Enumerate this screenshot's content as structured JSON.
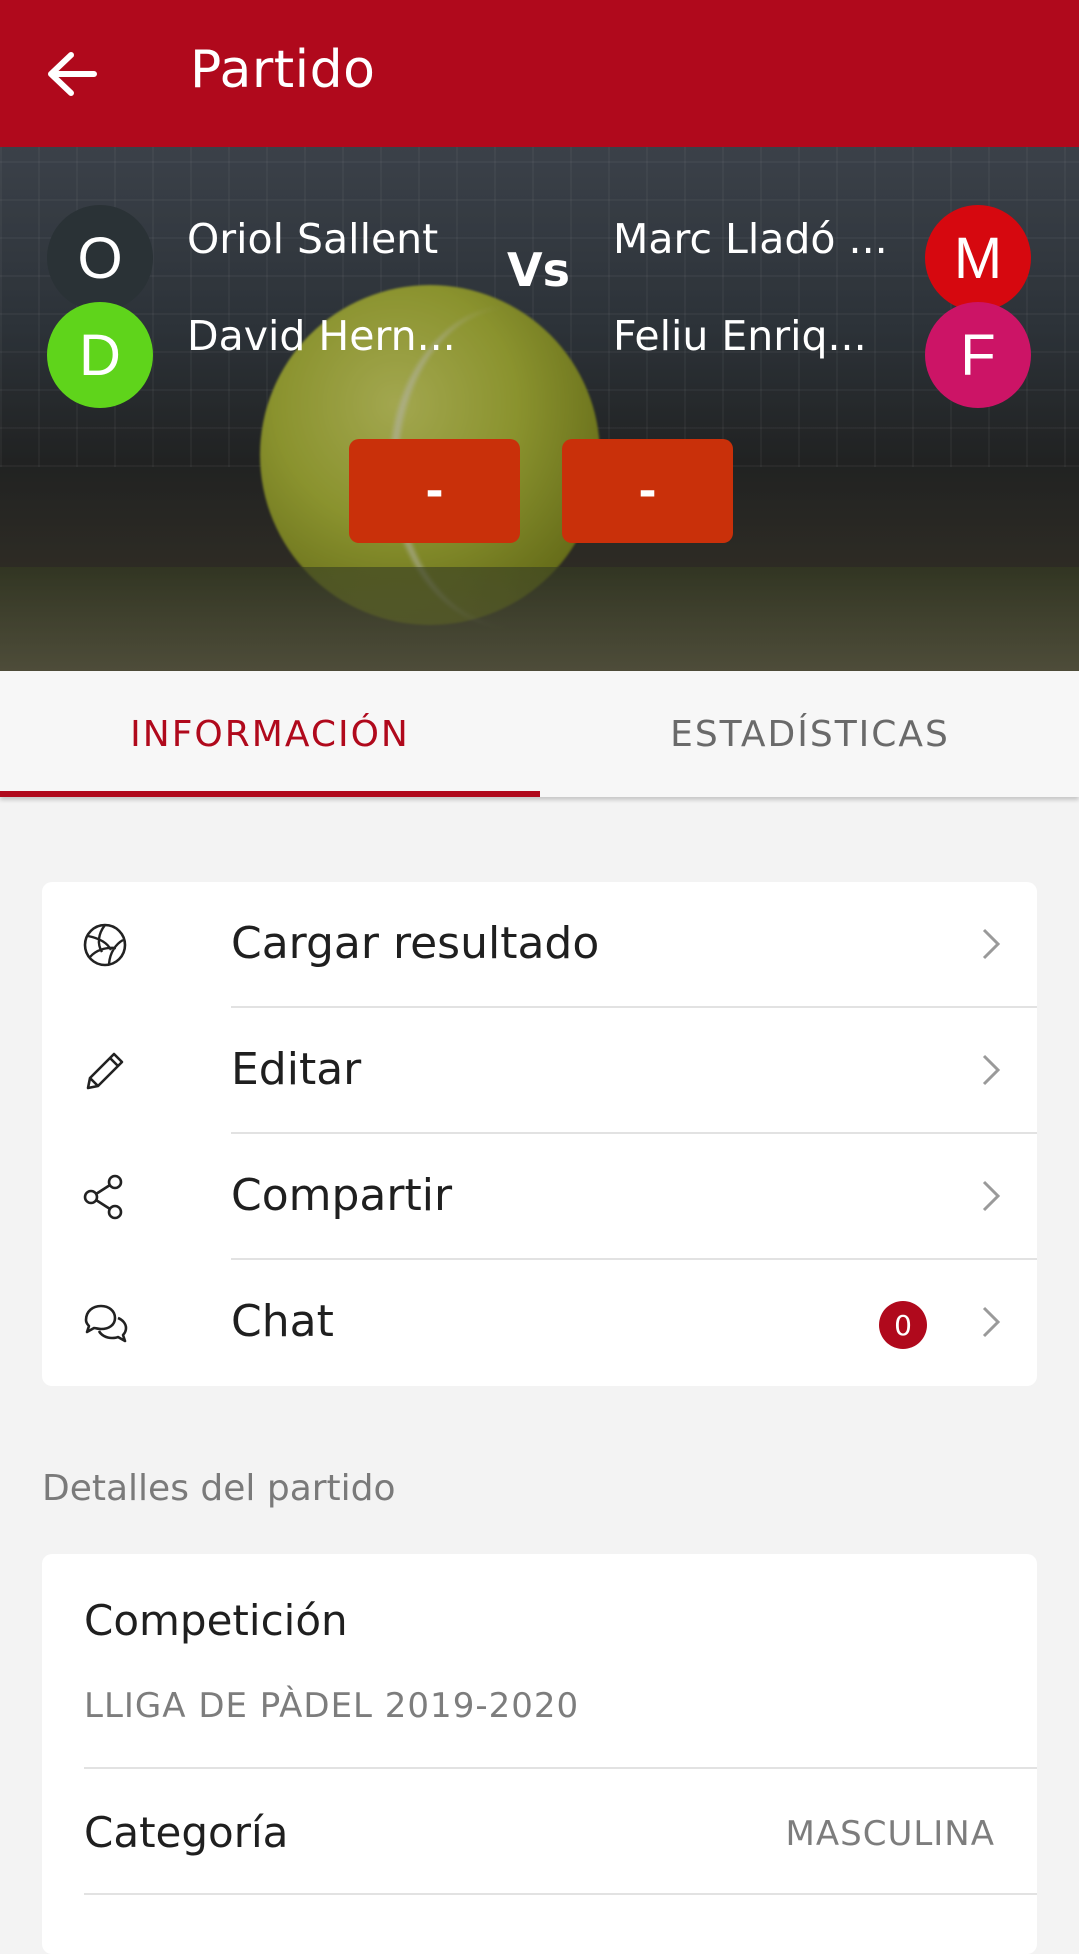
{
  "appbar": {
    "title": "Partido",
    "back_icon": "arrow-back-icon"
  },
  "match": {
    "team1": [
      {
        "initial": "O",
        "name": "Oriol Sallent",
        "color": "#2a3236"
      },
      {
        "initial": "D",
        "name": "David Hern...",
        "color": "#5fd41b"
      }
    ],
    "team2": [
      {
        "initial": "M",
        "name": "Marc Lladó ...",
        "color": "#d6080f"
      },
      {
        "initial": "F",
        "name": "Feliu Enriq...",
        "color": "#cc1466"
      }
    ],
    "vs": "Vs",
    "scores": [
      "-",
      "-"
    ]
  },
  "tabs": [
    {
      "label": "INFORMACIÓN",
      "active": true
    },
    {
      "label": "ESTADÍSTICAS",
      "active": false
    }
  ],
  "actions": [
    {
      "label": "Cargar resultado",
      "icon": "volleyball-icon"
    },
    {
      "label": "Editar",
      "icon": "pencil-icon"
    },
    {
      "label": "Compartir",
      "icon": "share-icon"
    },
    {
      "label": "Chat",
      "icon": "chat-icon",
      "badge": "0"
    }
  ],
  "details": {
    "section_title": "Detalles del partido",
    "competition_label": "Competición",
    "competition_value": "LLIGA DE PÀDEL 2019-2020",
    "category_label": "Categoría",
    "category_value": "MASCULINA"
  },
  "colors": {
    "primary": "#b0091c",
    "score_button": "#c9300a"
  }
}
